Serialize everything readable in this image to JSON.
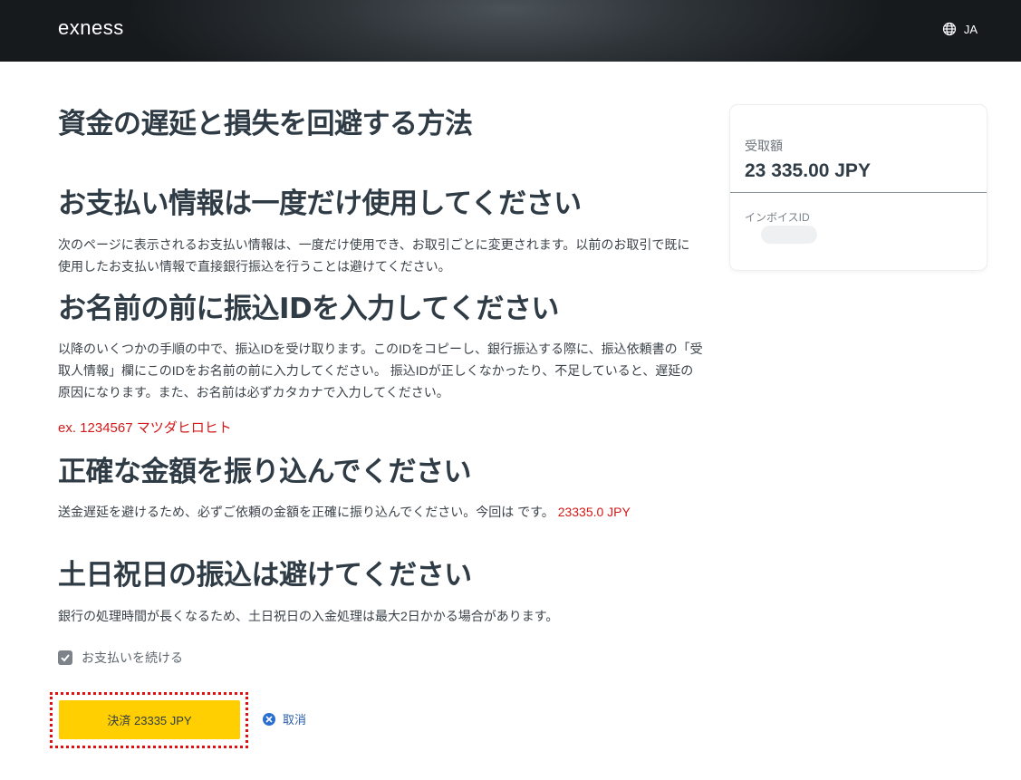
{
  "header": {
    "logo_text": "exness",
    "language": "JA",
    "globe_icon": "globe-icon"
  },
  "main": {
    "title": "資金の遅延と損失を回避する方法",
    "sections": [
      {
        "title": "お支払い情報は一度だけ使用してください",
        "text": "次のページに表示されるお支払い情報は、一度だけ使用でき、お取引ごとに変更されます。以前のお取引で既に使用したお支払い情報で直接銀行振込を行うことは避けてください。"
      },
      {
        "title": "お名前の前に振込IDを入力してください",
        "text": "以降のいくつかの手順の中で、振込IDを受け取ります。このIDをコピーし、銀行振込する際に、振込依頼書の「受取人情報」欄にこのIDをお名前の前に入力してください。 振込IDが正しくなかったり、不足していると、遅延の原因になります。また、お名前は必ずカタカナで入力してください。",
        "example": "ex. 1234567 マツダヒロヒト"
      },
      {
        "title": "正確な金額を振り込んでください",
        "text": "送金遅延を避けるため、必ずご依頼の金額を正確に振り込んでください。今回は です。",
        "amount": "23335.0 JPY"
      },
      {
        "title": "土日祝日の振込は避けてください",
        "text": "銀行の処理時間が長くなるため、土日祝日の入金処理は最大2日かかる場合があります。"
      }
    ],
    "confirm_label": "お支払いを続ける",
    "confirm_checked": true,
    "pay_button": "決済 23335 JPY",
    "cancel_label": "取消"
  },
  "summary": {
    "amount_label": "受取額",
    "amount_value": "23 335.00 JPY",
    "invoice_label": "インボイスID"
  },
  "colors": {
    "accent_yellow": "#ffcf01",
    "highlight_red": "#d21919",
    "link_blue": "#2a5ea8"
  }
}
